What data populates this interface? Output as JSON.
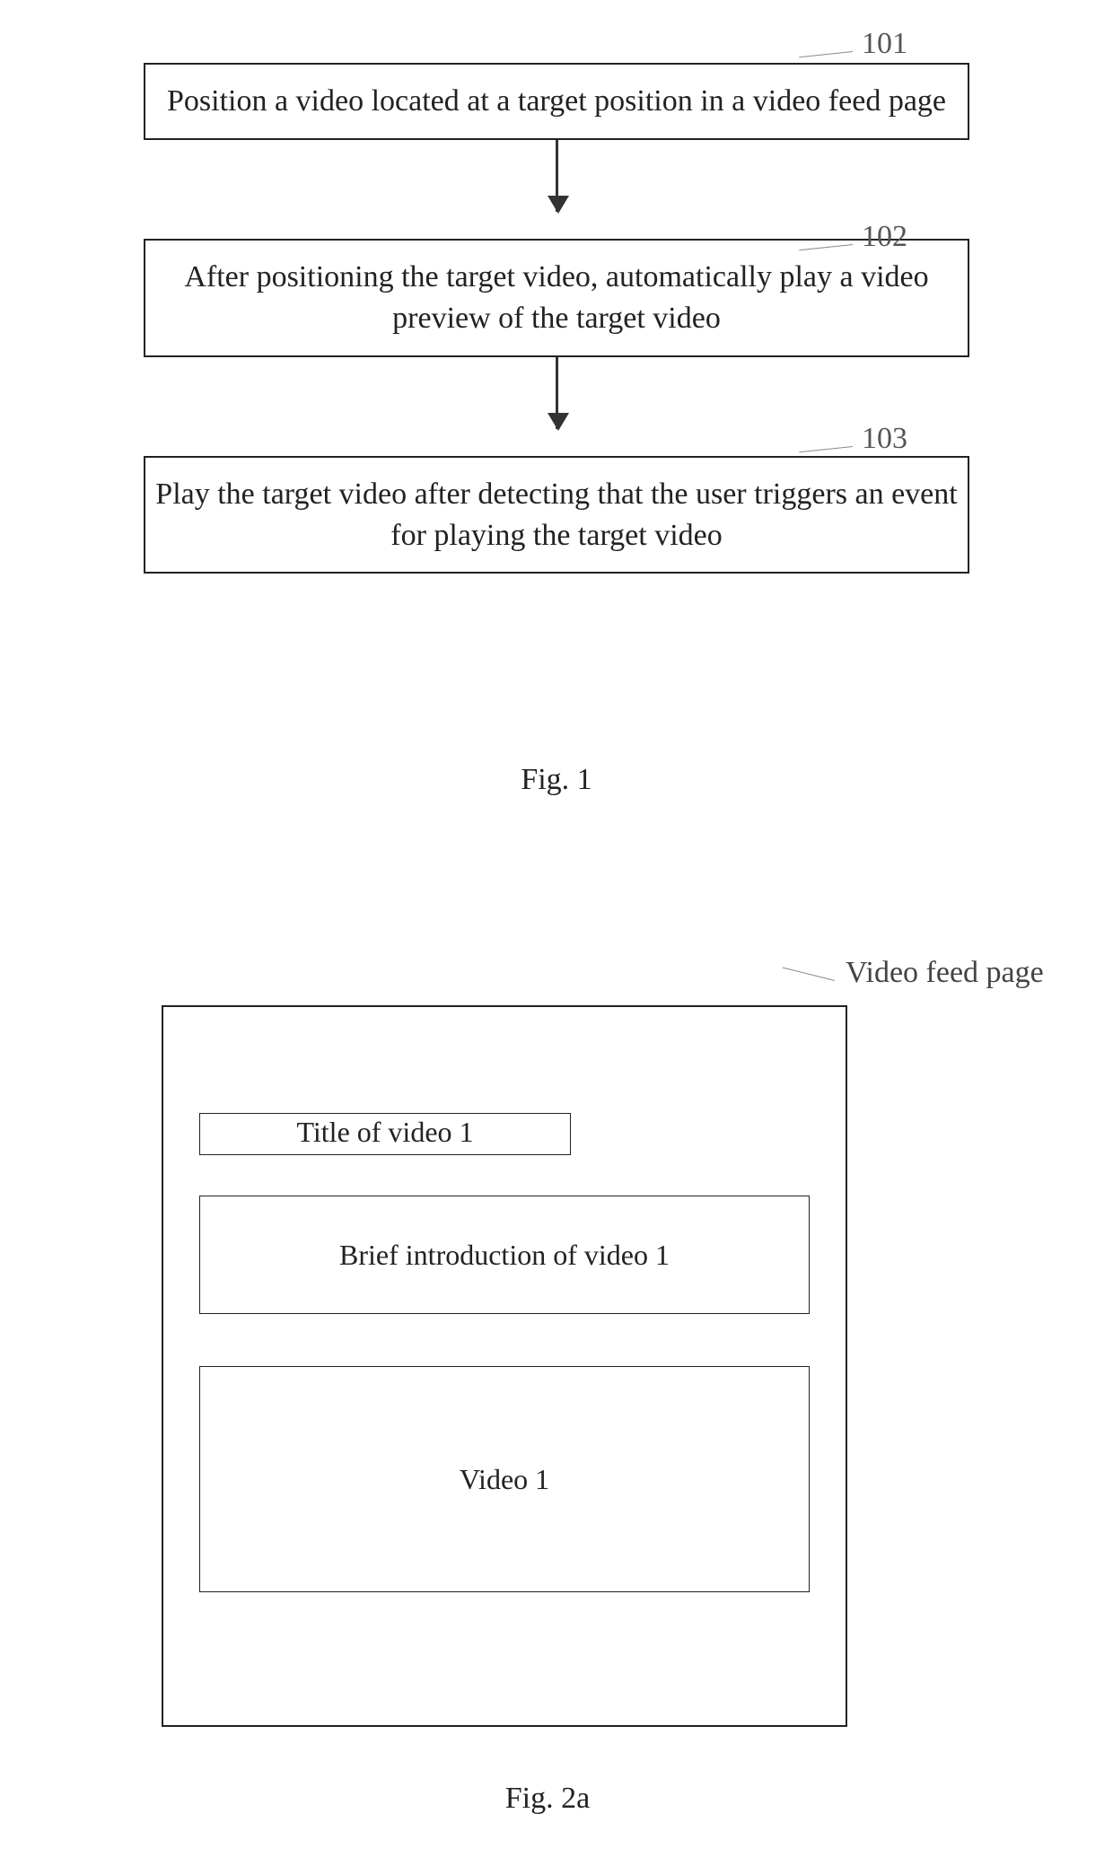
{
  "fig1": {
    "steps": [
      {
        "num": "101",
        "text": "Position a video located at a target position in a video feed page"
      },
      {
        "num": "102",
        "text": "After positioning the target video, automatically play a video preview of the target video"
      },
      {
        "num": "103",
        "text": "Play the target video after detecting that the user triggers an event for playing the target video"
      }
    ],
    "caption": "Fig. 1"
  },
  "fig2": {
    "page_label": "Video feed page",
    "title_box": "Title of video 1",
    "intro_box": "Brief introduction of video 1",
    "video_box": "Video 1",
    "caption": "Fig. 2a"
  }
}
